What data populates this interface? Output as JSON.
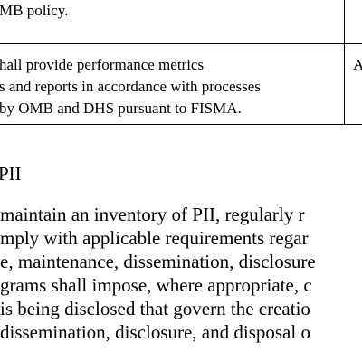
{
  "table": {
    "row1_text": "MB policy.",
    "row2_lines": [
      "hall provide performance metrics",
      "s and reports in accordance with processes",
      "by OMB and DHS pursuant to FISMA."
    ],
    "row2_right_cell": "A"
  },
  "section": {
    "heading": "PII",
    "body_lines": [
      "maintain an inventory of PII, regularly r",
      "mply with applicable requirements regar",
      "e, maintenance, dissemination, disclosure",
      "grams shall impose, where appropriate, c",
      "is being disclosed that govern the creatio",
      "dissemination, disclosure, and disposal o",
      "                                        "
    ]
  }
}
